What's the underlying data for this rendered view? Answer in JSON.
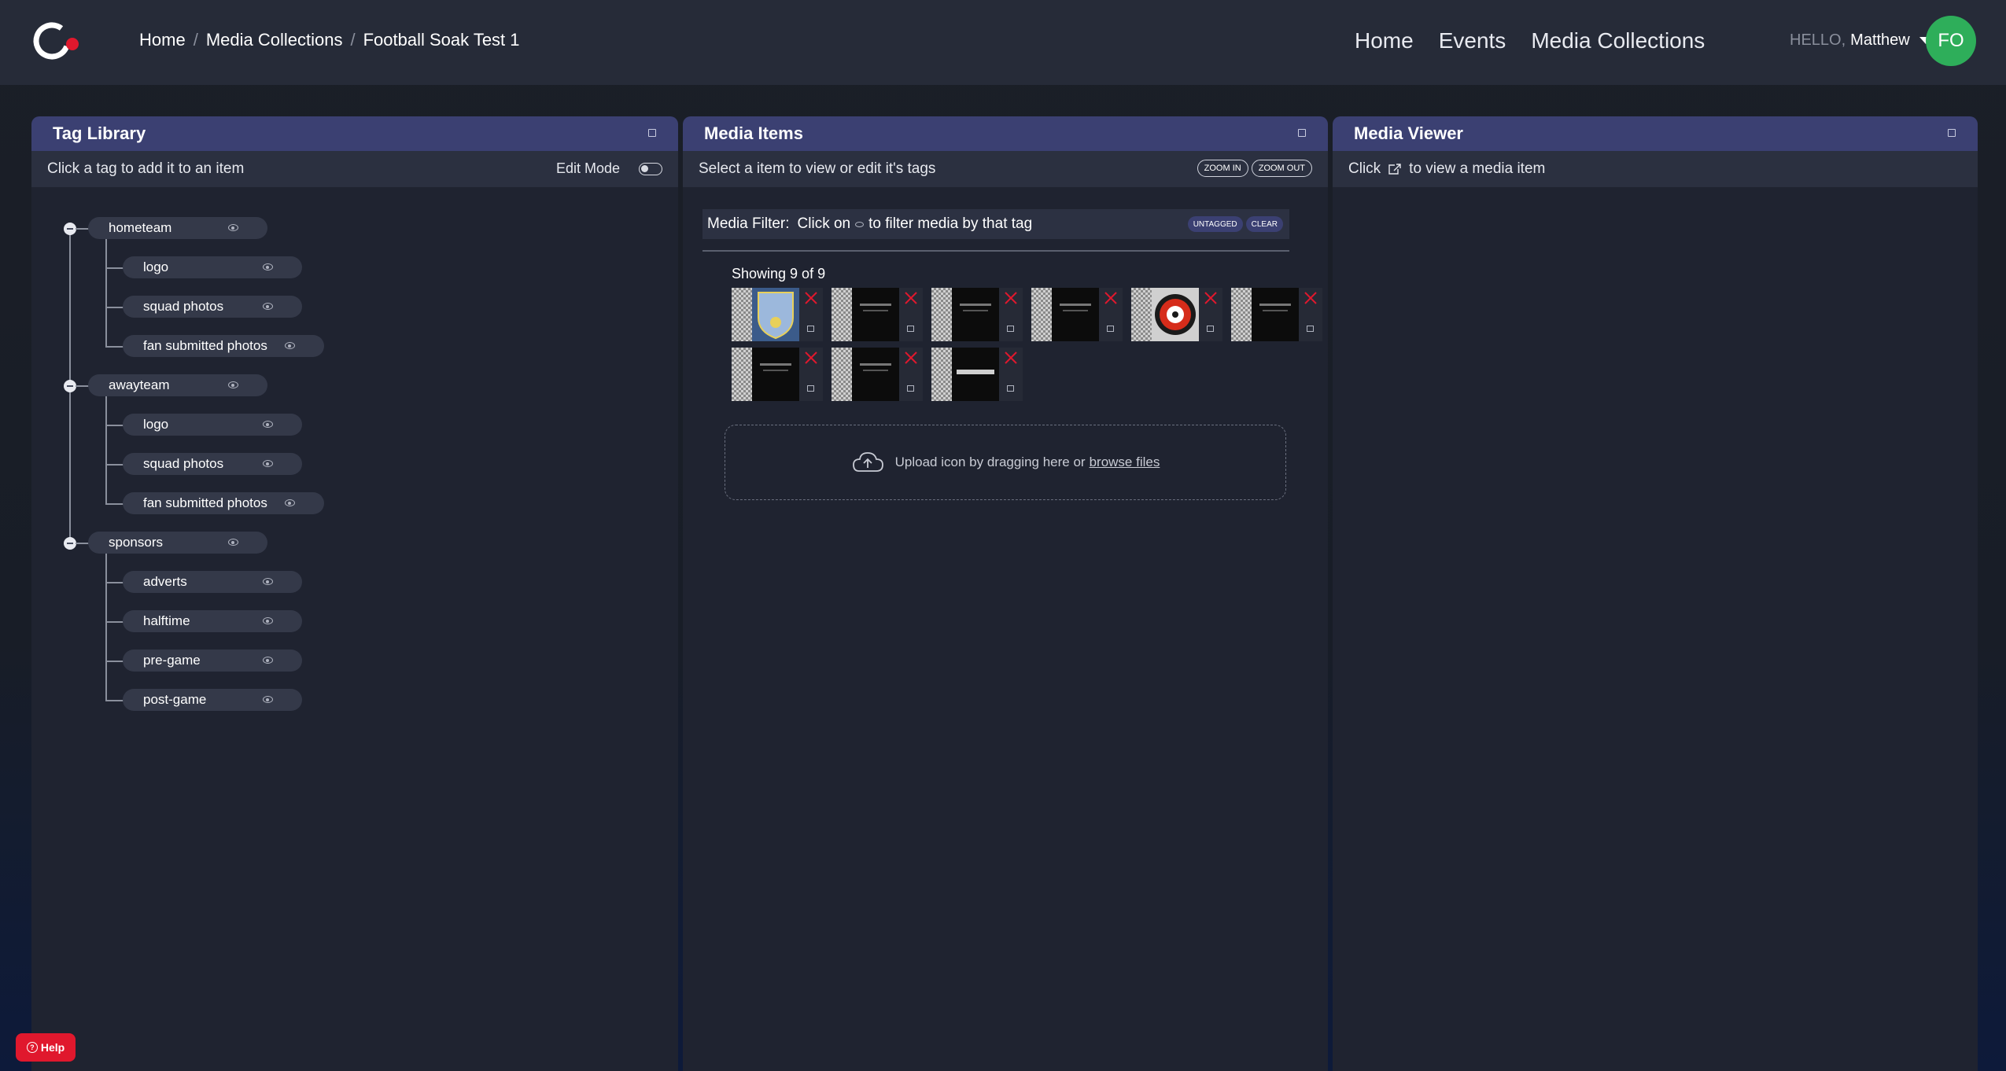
{
  "breadcrumb": [
    "Home",
    "Media Collections",
    "Football Soak Test 1"
  ],
  "nav": [
    "Home",
    "Events",
    "Media Collections"
  ],
  "user": {
    "greeting": "HELLO,",
    "name": "Matthew",
    "initials": "FO"
  },
  "tag_panel": {
    "title": "Tag Library",
    "hint": "Click a tag to add it to an item",
    "edit_mode_label": "Edit Mode",
    "groups": [
      {
        "label": "hometeam",
        "children": [
          "logo",
          "squad photos",
          "fan submitted photos"
        ]
      },
      {
        "label": "awayteam",
        "children": [
          "logo",
          "squad photos",
          "fan submitted photos"
        ]
      },
      {
        "label": "sponsors",
        "children": [
          "adverts",
          "halftime",
          "pre-game",
          "post-game"
        ]
      }
    ]
  },
  "media_panel": {
    "title": "Media Items",
    "hint": "Select a item to view or edit it's tags",
    "zoom_in": "ZOOM IN",
    "zoom_out": "ZOOM OUT",
    "filter_label": "Media Filter:",
    "filter_hint_pre": "Click on",
    "filter_hint_post": "to filter media by that tag",
    "untagged": "UNTAGGED",
    "clear": "CLEAR",
    "showing": "Showing 9 of 9",
    "upload_text": "Upload icon by dragging here or",
    "browse_files": "browse files"
  },
  "viewer_panel": {
    "title": "Media Viewer",
    "hint_pre": "Click",
    "hint_post": "to view a media item"
  },
  "help_label": "Help",
  "colors": {
    "accent_header": "#3b4072",
    "avatar": "#2eae5a",
    "help": "#e0182d",
    "logo_dot": "#e0182d"
  }
}
